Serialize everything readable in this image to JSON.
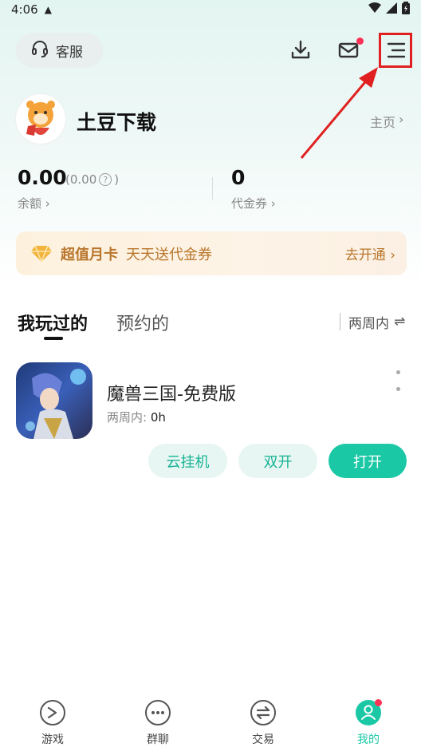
{
  "status_bar": {
    "time": "4:06"
  },
  "header": {
    "customer_service_label": "客服"
  },
  "profile": {
    "username": "土豆下载",
    "home_link": "主页"
  },
  "wallet": {
    "balance_value": "0.00",
    "balance_paren_open": "(0.00",
    "balance_paren_close": ")",
    "balance_label": "余额",
    "voucher_value": "0",
    "voucher_label": "代金券"
  },
  "vip_banner": {
    "title": "超值月卡",
    "description": "天天送代金券",
    "cta": "去开通"
  },
  "tabs": {
    "played": "我玩过的",
    "reserved": "预约的",
    "filter": "两周内"
  },
  "game": {
    "title": "魔兽三国-免费版",
    "time_label": "两周内:",
    "time_value": "0h",
    "buttons": {
      "cloud": "云挂机",
      "dual": "双开",
      "open": "打开"
    }
  },
  "bottom_nav": [
    {
      "label": "游戏",
      "icon": "game-icon"
    },
    {
      "label": "群聊",
      "icon": "chat-icon"
    },
    {
      "label": "交易",
      "icon": "trade-icon"
    },
    {
      "label": "我的",
      "icon": "profile-icon"
    }
  ],
  "colors": {
    "accent": "#1bc8a6",
    "vip_text": "#b9762c",
    "badge_red": "#ff3355",
    "annotation_red": "#e02020"
  }
}
